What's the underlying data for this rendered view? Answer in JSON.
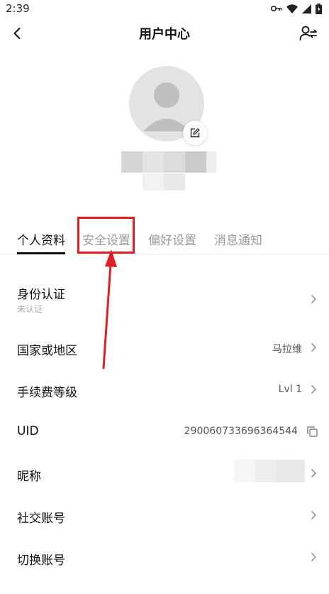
{
  "status": {
    "time": "2:39"
  },
  "header": {
    "title": "用户中心"
  },
  "tabs": [
    {
      "label": "个人资料",
      "active": true
    },
    {
      "label": "安全设置",
      "active": false
    },
    {
      "label": "偏好设置",
      "active": false
    },
    {
      "label": "消息通知",
      "active": false
    }
  ],
  "rows": [
    {
      "label": "身份认证",
      "sub": "未认证",
      "value": ""
    },
    {
      "label": "国家或地区",
      "value": "马拉维"
    },
    {
      "label": "手续费等级",
      "value": "Lvl 1"
    },
    {
      "label": "UID",
      "value": "290060733696364544"
    },
    {
      "label": "昵称",
      "value": ""
    },
    {
      "label": "社交账号",
      "value": ""
    },
    {
      "label": "切换账号",
      "value": ""
    }
  ],
  "colors": {
    "annotation": "#e02020",
    "avatar_bg": "#e3e3e3"
  },
  "icons": [
    "back-arrow-icon",
    "switch-user-icon",
    "edit-icon",
    "chevron-right-icon",
    "copy-icon",
    "wifi-icon",
    "key-icon",
    "signal-icon",
    "battery-icon"
  ]
}
